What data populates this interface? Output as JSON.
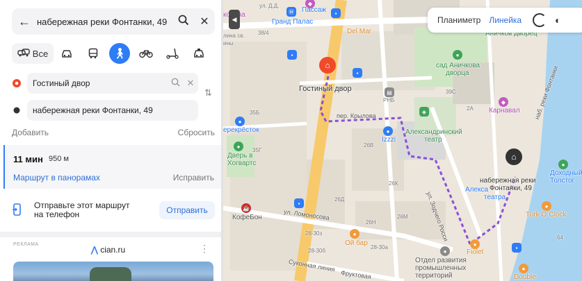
{
  "search": {
    "query": "набережная реки Фонтанки, 49"
  },
  "modes": {
    "all_label": "Все"
  },
  "route_points": {
    "from": "Гостиный двор",
    "to": "набережная реки Фонтанки, 49"
  },
  "actions": {
    "add": "Добавить",
    "reset": "Сбросить"
  },
  "route": {
    "time": "11 мин",
    "distance": "950 м",
    "panorama_link": "Маршрут в панорамах",
    "fix_link": "Исправить"
  },
  "send": {
    "text_line1": "Отправьте этот маршрут",
    "text_line2": "на телефон",
    "button": "Отправить"
  },
  "ad": {
    "label": "РЕКЛАМА",
    "brand": "cian.ru"
  },
  "map_controls": {
    "planimeter": "Планиметр",
    "ruler": "Линейка"
  },
  "map_labels": {
    "street_dd": "ул. Д.Д.",
    "kovicha": "ковича",
    "passage": "Пассаж",
    "grand_palace": "Гранд Палас",
    "del_mar": "Del Mar",
    "anichkov_palace": "Аничков дворец",
    "garden_line1": "сад Аничкова",
    "garden_line2": "дворца",
    "gostiny_dvor": "Гостиный двор",
    "rnb": "РНБ",
    "karnaval": "Карнавал",
    "perekrestok": "ерекрёсток",
    "krylova": "пер. Крылова",
    "theatre_line1": "Александринский",
    "theatre_line2": "театр",
    "izzzi": "Izzzi",
    "dver_line1": "Дверь в",
    "dver_line2": "Хогвартс",
    "zodchego": "ул. Зодчего Росси",
    "dest_line1": "набережная реки",
    "dest_line2": "Фонтанки, 49",
    "dohodny_line1": "Доходный",
    "dohodny_line2": "Толстог",
    "aleksa": "Алекса",
    "teatra": "театра",
    "fontanka_emb": "наб. реки Фонтанки",
    "turk": "Turk O`Clock",
    "kofebon": "КофеБон",
    "lomonosova": "ул. Ломоносова",
    "oy_bar": "Ой бар",
    "sukonnaya": "Суконная линия",
    "fruktovaya": "Фруктовая",
    "otdel_line1": "Отдел развития",
    "otdel_line2": "промышленных",
    "otdel_line3": "территорий",
    "fiolet": "Fiolet",
    "double": "Double",
    "b_26b": "26В",
    "b_26k": "26К",
    "b_26m": "26М",
    "b_26d": "26Д",
    "b_26n": "26Н",
    "b_35b": "35Б",
    "b_35g": "35Г",
    "b_39c": "39С",
    "b_2a": "2А",
    "b_38": "38/4",
    "b_28_30a": "28-30а",
    "b_28_30b": "28-30б",
    "b_28_30z": "28-30з",
    "b_64": "64",
    "lina_sv": "лина св.",
    "niny": "ины"
  },
  "colors": {
    "accent": "#2e7cf6",
    "route": "#8a4fd6",
    "origin_pin": "#f04a2a",
    "dest_pin": "#333333",
    "water": "#a8d3f0",
    "road_major": "#f7c96a"
  }
}
